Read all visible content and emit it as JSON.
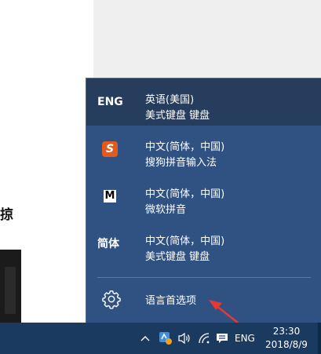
{
  "background": {
    "partial_text": "掠"
  },
  "flyout": {
    "languages": [
      {
        "icon_text": "ENG",
        "icon": "eng-text-icon",
        "line1": "英语(美国)",
        "line2": "美式键盘 键盘",
        "selected": true
      },
      {
        "icon_text": "S",
        "icon": "sogou-icon",
        "line1": "中文(简体，中国)",
        "line2": "搜狗拼音输入法",
        "selected": false
      },
      {
        "icon_text": "M",
        "icon": "microsoft-pinyin-icon",
        "line1": "中文(简体，中国)",
        "line2": "微软拼音",
        "selected": false
      },
      {
        "icon_text": "简体",
        "icon": "simplified-text-icon",
        "line1": "中文(简体，中国)",
        "line2": "美式键盘 键盘",
        "selected": false
      }
    ],
    "preferences_label": "语言首选项",
    "preferences_icon": "gear-icon"
  },
  "taskbar": {
    "icons": [
      "chevron-up-icon",
      "app-tray-icon",
      "volume-icon",
      "wifi-icon",
      "action-center-icon"
    ],
    "input_indicator": "ENG",
    "time": "23:30",
    "date": "2018/8/9"
  },
  "colors": {
    "flyout_bg": "#2f5283",
    "selected_bg": "#263d5e",
    "taskbar_bg": "#1a3b5f",
    "arrow": "#e53935",
    "sogou": "#e15a1f"
  }
}
